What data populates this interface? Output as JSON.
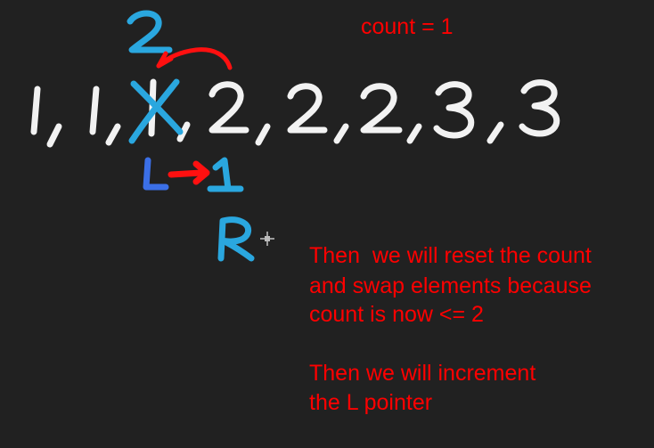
{
  "background": "#212121",
  "colors": {
    "chalk": "#f2f2f2",
    "cyan": "#2aa7df",
    "blue": "#3b6fe6",
    "red": "#ff1010"
  },
  "count_label": "count = 1",
  "sequence": [
    "1",
    "1",
    "1",
    "2",
    "2",
    "2",
    "3",
    "3"
  ],
  "crossed_index": 2,
  "replacement_above": "2",
  "pointers": {
    "l_label": "L",
    "l_new_value": "1",
    "r_label": "R"
  },
  "notes": [
    "Then  we will reset the count",
    "and swap elements because",
    "count is now <= 2",
    "Then we will increment",
    "the L pointer"
  ],
  "icons": {
    "cursor": "crosshair-cursor-icon"
  }
}
